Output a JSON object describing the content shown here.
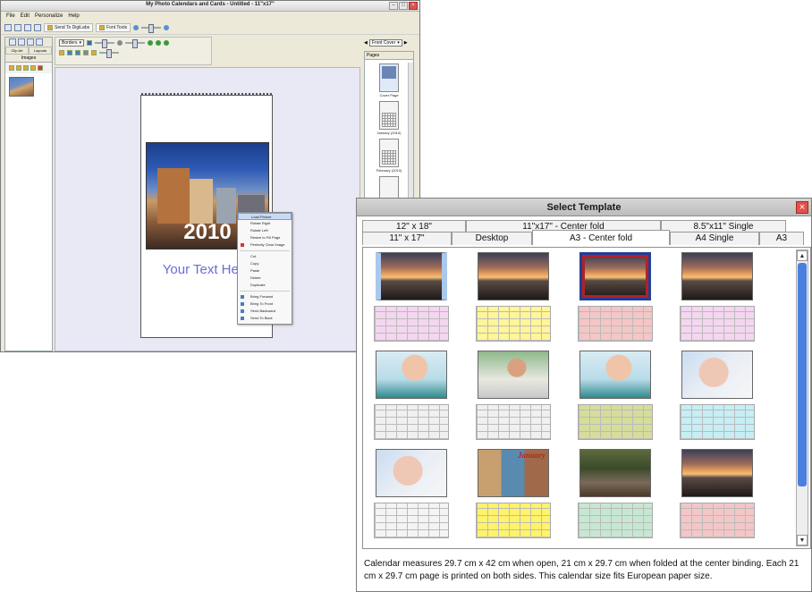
{
  "app": {
    "title": "My Photo Calendars and Cards - Untitled - 11\"x17\"",
    "menu": [
      "File",
      "Edit",
      "Personalize",
      "Help"
    ],
    "toolbar_send_label": "Send To DigiLabs",
    "toolbar_fonttools_label": "Font Tools",
    "left_tabs": [
      "Clip Art",
      "Layouts"
    ],
    "left_images_tab": "Images",
    "borders_select": "Borders",
    "cover_year": "2010",
    "cover_text": "Your Text Here",
    "nav_select": "Front Cover",
    "pages_label": "Pages",
    "page_thumbs": [
      "Cover Page",
      "January (2010)",
      "February (2010)"
    ],
    "context_menu": [
      "Load Picture",
      "Rotate Right",
      "Rotate Left",
      "Resize to Fill Page",
      "Perfectly Clear Image",
      "Cut",
      "Copy",
      "Paste",
      "Delete",
      "Duplicate",
      "Bring Forward",
      "Bring To Front",
      "Send Backward",
      "Send To Back"
    ]
  },
  "dialog": {
    "title": "Select Template",
    "tabs_back": [
      "12\" x 18\"",
      "11\"x17\" - Center fold",
      "8.5\"x11\" Single"
    ],
    "tabs_front": [
      "11\" x 17\"",
      "Desktop",
      "A3 - Center fold",
      "A4 Single",
      "A3"
    ],
    "active_tab": "A3 - Center fold",
    "templates": [
      {
        "photo": "sunset"
      },
      {
        "photo": "sunset"
      },
      {
        "photo": "sunset"
      },
      {
        "photo": "sunset"
      },
      {
        "photo": "woman"
      },
      {
        "photo": "man"
      },
      {
        "photo": "woman"
      },
      {
        "photo": "baby"
      },
      {
        "photo": "baby"
      },
      {
        "photo": "collage"
      },
      {
        "photo": "family"
      },
      {
        "photo": "sunset"
      }
    ],
    "collage_label": "January",
    "description": "Calendar measures 29.7 cm x 42 cm when open, 21 cm x 29.7 cm when folded at the center binding. Each 21 cm x 29.7 cm page is printed on both sides. This calendar size fits European paper size."
  }
}
